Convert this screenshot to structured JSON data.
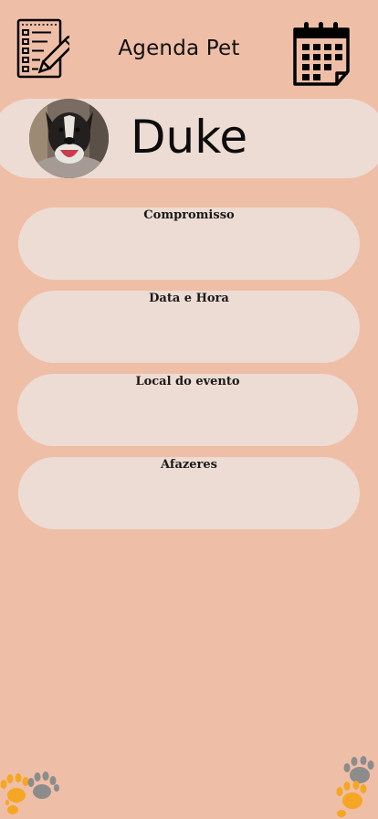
{
  "header": {
    "title": "Agenda Pet",
    "left_icon": "checklist-icon",
    "right_icon": "calendar-icon"
  },
  "profile": {
    "name": "Duke",
    "avatar_icon": "dog-photo"
  },
  "form": {
    "fields": [
      {
        "label": "Compromisso"
      },
      {
        "label": "Data e Hora"
      },
      {
        "label": "Local do evento"
      },
      {
        "label": "Afazeres"
      }
    ]
  },
  "decor": {
    "left": "paw-prints-icon",
    "right": "paw-prints-icon"
  },
  "colors": {
    "background": "#efbea7",
    "card": "#eddcd3",
    "paw_orange": "#f5a623",
    "paw_gray": "#8c8c8c"
  }
}
